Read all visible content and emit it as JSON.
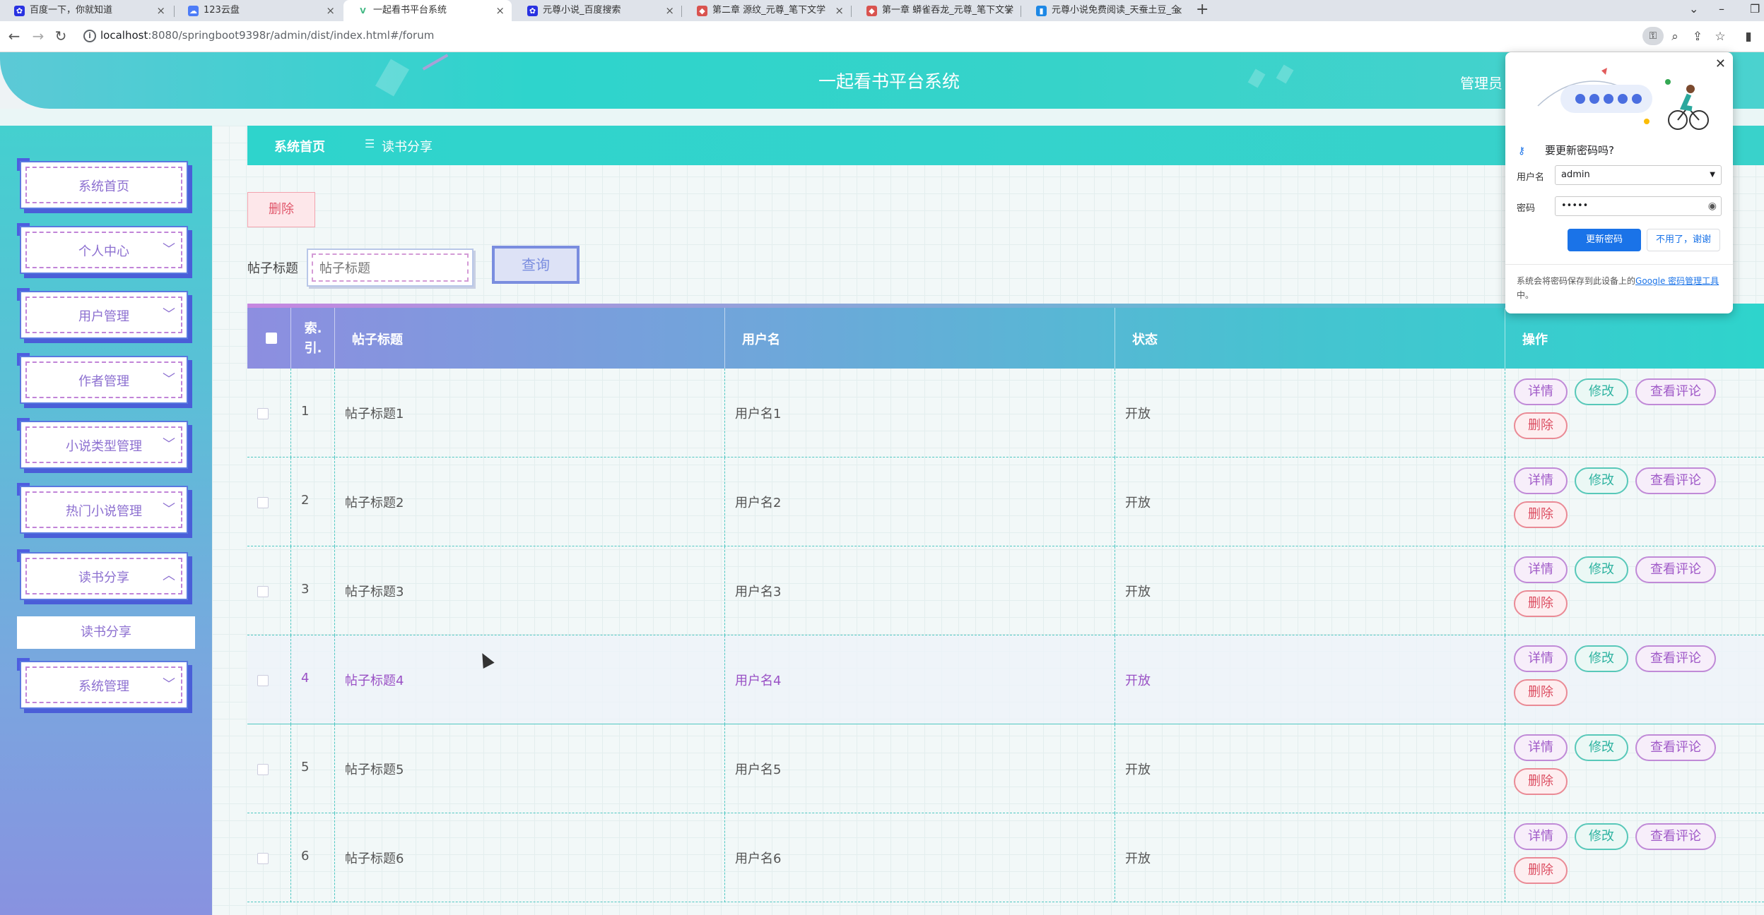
{
  "browser": {
    "tabs": [
      {
        "title": "百度一下，你就知道",
        "icon": "baidu-paw-icon",
        "color": "#2932e1"
      },
      {
        "title": "123云盘",
        "icon": "cloud-drive-icon",
        "color": "#4d7cf7"
      },
      {
        "title": "一起看书平台系统",
        "icon": "vue-logo-icon",
        "color": "#41b883"
      },
      {
        "title": "元尊小说_百度搜索",
        "icon": "baidu-paw-icon",
        "color": "#2932e1"
      },
      {
        "title": "第二章 源纹_元尊_笔下文学",
        "icon": "site-icon",
        "color": "#d9534f"
      },
      {
        "title": "第一章 蟒雀吞龙_元尊_笔下文学",
        "icon": "site-icon",
        "color": "#d9534f"
      },
      {
        "title": "元尊小说免费阅读_天蚕土豆_全",
        "icon": "book-icon",
        "color": "#1e88e5"
      }
    ],
    "url_host": "localhost",
    "url_path": ":8080/springboot9398r/admin/dist/index.html#/forum"
  },
  "header": {
    "title": "一起看书平台系统",
    "admin_label": "管理员"
  },
  "sidebar": {
    "items": [
      {
        "label": "系统首页",
        "chevron": ""
      },
      {
        "label": "个人中心",
        "chevron": "﹀"
      },
      {
        "label": "用户管理",
        "chevron": "﹀"
      },
      {
        "label": "作者管理",
        "chevron": "﹀"
      },
      {
        "label": "小说类型管理",
        "chevron": "﹀"
      },
      {
        "label": "热门小说管理",
        "chevron": "﹀"
      },
      {
        "label": "读书分享",
        "chevron": "︿"
      },
      {
        "label": "系统管理",
        "chevron": "﹀"
      }
    ],
    "submenu": {
      "label": "读书分享"
    }
  },
  "breadcrumb": {
    "home": "系统首页",
    "separator": "☰",
    "current": "读书分享"
  },
  "toolbar": {
    "delete_label": "删除",
    "search_label": "帖子标题",
    "search_placeholder": "帖子标题",
    "query_label": "查询"
  },
  "table": {
    "headers": {
      "index": "索\n引",
      "title": "帖子标题",
      "username": "用户名",
      "status": "状态",
      "actions": "操作"
    },
    "rows": [
      {
        "index": "1",
        "title": "帖子标题1",
        "username": "用户名1",
        "status": "开放"
      },
      {
        "index": "2",
        "title": "帖子标题2",
        "username": "用户名2",
        "status": "开放"
      },
      {
        "index": "3",
        "title": "帖子标题3",
        "username": "用户名3",
        "status": "开放"
      },
      {
        "index": "4",
        "title": "帖子标题4",
        "username": "用户名4",
        "status": "开放"
      },
      {
        "index": "5",
        "title": "帖子标题5",
        "username": "用户名5",
        "status": "开放"
      },
      {
        "index": "6",
        "title": "帖子标题6",
        "username": "用户名6",
        "status": "开放"
      }
    ],
    "actions": {
      "detail": "详情",
      "edit": "修改",
      "comments": "查看评论",
      "delete": "删除"
    }
  },
  "password_popup": {
    "title": "要更新密码吗?",
    "username_label": "用户名",
    "username_value": "admin",
    "password_label": "密码",
    "password_value": "•••••",
    "update_label": "更新密码",
    "dismiss_label": "不用了，谢谢",
    "footer_text": "系统会将密码保存到此设备上的",
    "footer_link": "Google 密码管理工具",
    "footer_end": "中。"
  }
}
